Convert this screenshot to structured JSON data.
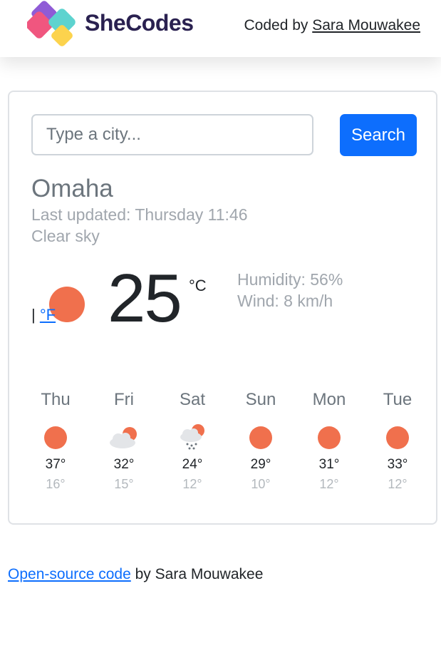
{
  "header": {
    "brand": "SheCodes",
    "credit_prefix": "Coded by",
    "credit_author": "Sara Mouwakee"
  },
  "search": {
    "placeholder": "Type a city...",
    "button_label": "Search"
  },
  "current": {
    "city": "Omaha",
    "last_updated": "Last updated: Thursday 11:46",
    "description": "Clear sky",
    "temperature": "25",
    "unit_celsius": "°C",
    "unit_separator": "|",
    "unit_fahrenheit": "°F",
    "humidity": "Humidity: 56%",
    "wind": "Wind: 8 km/h",
    "icon": "sun-icon"
  },
  "forecast": [
    {
      "day": "Thu",
      "high": "37°",
      "low": "16°",
      "icon": "sun-icon"
    },
    {
      "day": "Fri",
      "high": "32°",
      "low": "15°",
      "icon": "partly-cloudy-icon"
    },
    {
      "day": "Sat",
      "high": "24°",
      "low": "12°",
      "icon": "snow-cloud-icon"
    },
    {
      "day": "Sun",
      "high": "29°",
      "low": "10°",
      "icon": "sun-icon"
    },
    {
      "day": "Mon",
      "high": "31°",
      "low": "12°",
      "icon": "sun-icon"
    },
    {
      "day": "Tue",
      "high": "33°",
      "low": "12°",
      "icon": "sun-icon"
    }
  ],
  "footer": {
    "link_text": "Open-source code",
    "suffix": "by Sara Mouwakee"
  },
  "colors": {
    "accent": "#0d6efd",
    "sun": "#f0704d",
    "brand_text": "#2a2150"
  }
}
